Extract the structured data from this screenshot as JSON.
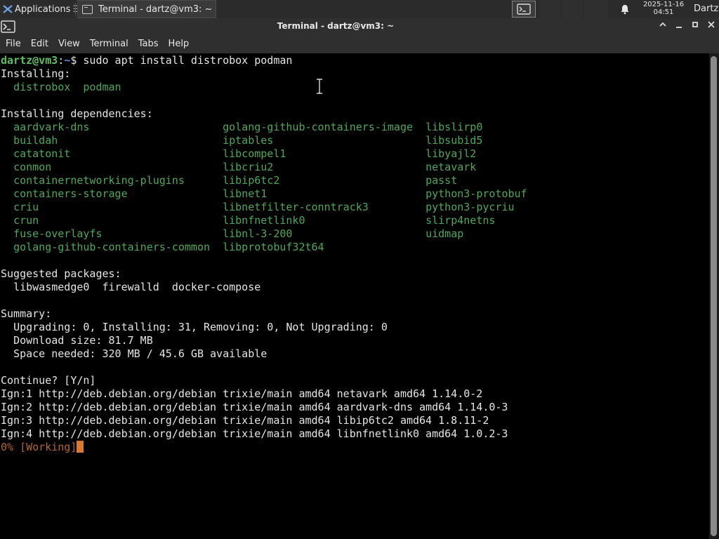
{
  "panel": {
    "applications_label": "Applications",
    "task_title": "Terminal - dartz@vm3: ~",
    "clock_date": "2025-11-16",
    "clock_time": "04:51",
    "user": "Dartz"
  },
  "window": {
    "title": "Terminal - dartz@vm3: ~"
  },
  "menu": [
    "File",
    "Edit",
    "View",
    "Terminal",
    "Tabs",
    "Help"
  ],
  "terminal": {
    "prompt_user": "dartz@vm3",
    "prompt_path": "~",
    "command": "sudo apt install distrobox podman",
    "installing_header": "Installing:",
    "installing": [
      "distrobox",
      "podman"
    ],
    "deps_header": "Installing dependencies:",
    "deps_columns": [
      [
        "aardvark-dns",
        "buildah",
        "catatonit",
        "conmon",
        "containernetworking-plugins",
        "containers-storage",
        "criu",
        "crun",
        "fuse-overlayfs",
        "golang-github-containers-common"
      ],
      [
        "golang-github-containers-image",
        "iptables",
        "libcompel1",
        "libcriu2",
        "libip6tc2",
        "libnet1",
        "libnetfilter-conntrack3",
        "libnfnetlink0",
        "libnl-3-200",
        "libprotobuf32t64"
      ],
      [
        "libslirp0",
        "libsubid5",
        "libyajl2",
        "netavark",
        "passt",
        "python3-protobuf",
        "python3-pycriu",
        "slirp4netns",
        "uidmap"
      ]
    ],
    "suggested_header": "Suggested packages:",
    "suggested": [
      "libwasmedge0",
      "firewalld",
      "docker-compose"
    ],
    "summary_header": "Summary:",
    "summary_lines": [
      "Upgrading: 0, Installing: 31, Removing: 0, Not Upgrading: 0",
      "Download size: 81.7 MB",
      "Space needed: 320 MB / 45.6 GB available"
    ],
    "continue_line": "Continue? [Y/n]",
    "ign_lines": [
      "Ign:1 http://deb.debian.org/debian trixie/main amd64 netavark amd64 1.14.0-2",
      "Ign:2 http://deb.debian.org/debian trixie/main amd64 aardvark-dns amd64 1.14.0-3",
      "Ign:3 http://deb.debian.org/debian trixie/main amd64 libip6tc2 amd64 1.8.11-2",
      "Ign:4 http://deb.debian.org/debian trixie/main amd64 libnfnetlink0 amd64 1.0.2-3"
    ],
    "progress_line": "0% [Working]"
  },
  "colors": {
    "package_green": "#4ea85a",
    "prompt_green": "#5fc15f",
    "prompt_blue": "#5c8ed8",
    "working_orange": "#b5652a",
    "cursor_orange": "#d97a2c"
  }
}
